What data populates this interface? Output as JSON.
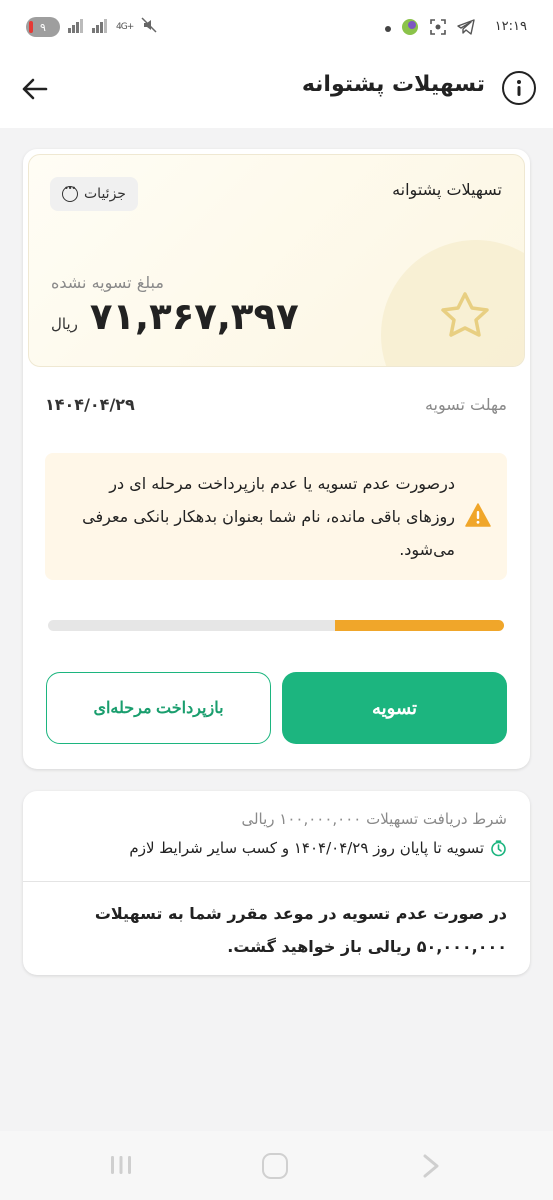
{
  "status_bar": {
    "time": "۱۲:۱۹",
    "battery_level": "۹",
    "network": "4G+"
  },
  "header": {
    "title": "تسهیلات پشتوانه"
  },
  "card": {
    "hero_title": "تسهیلات پشتوانه",
    "details_label": "جزئیات",
    "amount_caption": "مبلغ تسویه نشده",
    "amount_value": "۷۱,۳۶۷,۳۹۷",
    "amount_currency": "ریال",
    "deadline_label": "مهلت تسویه",
    "deadline_value": "۱۴۰۴/۰۴/۲۹",
    "warning_text": "درصورت عدم تسویه یا عدم بازپرداخت مرحله ای در روزهای باقی مانده، نام شما بعنوان بدهکار بانکی معرفی می‌شود.",
    "progress_fraction": 0.37,
    "settle_label": "تسویه",
    "installment_label": "بازپرداخت مرحله‌ای"
  },
  "info_card": {
    "condition_title": "شرط دریافت تسهیلات ۱۰۰,۰۰۰,۰۰۰ ریالی",
    "condition_text": "تسویه تا پایان روز ۱۴۰۴/۰۴/۲۹ و کسب سایر شرایط لازم",
    "result_text": "در صورت عدم تسویه در موعد مقرر شما به تسهیلات ۵۰,۰۰۰,۰۰۰ ریالی باز خواهید گشت."
  },
  "colors": {
    "accent_green": "#1cb57f",
    "progress_orange": "#f0a62a",
    "warning_bg": "#fff7e8"
  }
}
